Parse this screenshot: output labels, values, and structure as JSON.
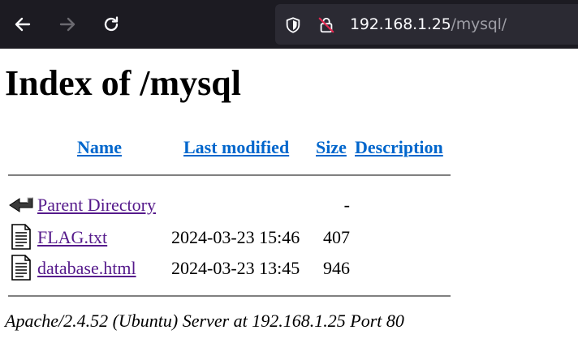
{
  "browser": {
    "url_host": "192.168.1.25",
    "url_path": "/mysql/",
    "icons": [
      "back-arrow-icon",
      "forward-arrow-icon",
      "reload-icon",
      "shield-icon",
      "insecure-lock-icon"
    ]
  },
  "page": {
    "title": "Index of /mysql",
    "columns": {
      "name": "Name",
      "last_modified": "Last modified",
      "size": "Size",
      "description": "Description"
    },
    "entries": [
      {
        "icon": "parent-directory-icon",
        "name": "Parent Directory",
        "last_modified": "",
        "size": "-",
        "description": ""
      },
      {
        "icon": "text-file-icon",
        "name": "FLAG.txt",
        "last_modified": "2024-03-23 15:46",
        "size": "407",
        "description": ""
      },
      {
        "icon": "text-file-icon",
        "name": "database.html",
        "last_modified": "2024-03-23 13:45",
        "size": "946",
        "description": ""
      }
    ],
    "footer": "Apache/2.4.52 (Ubuntu) Server at 192.168.1.25 Port 80"
  },
  "colors": {
    "toolbar_bg": "#1c1b22",
    "urlbar_bg": "#2b2a33",
    "link_header": "#0066cc",
    "link_visited": "#551a8b",
    "rule": "#808080"
  }
}
